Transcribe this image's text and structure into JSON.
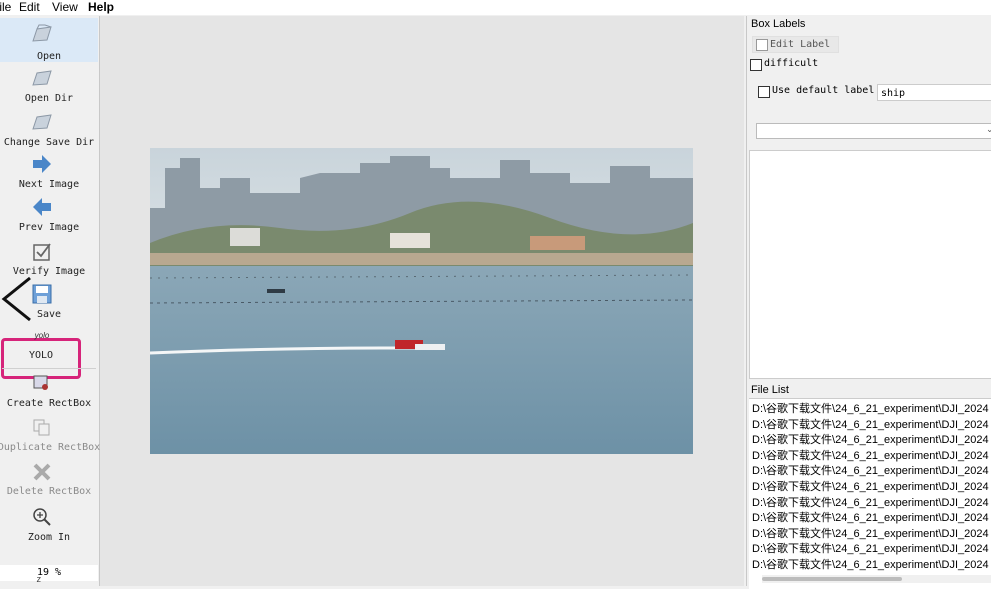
{
  "menubar": {
    "file": "File",
    "edit": "Edit",
    "view": "View",
    "help": "Help"
  },
  "toolbar": {
    "open": "Open",
    "open_dir": "Open Dir",
    "change_save_dir": "Change Save Dir",
    "next_image": "Next Image",
    "prev_image": "Prev Image",
    "verify_image": "Verify Image",
    "save": "Save",
    "yolo_icon_text": "yolo",
    "yolo": "YOLO",
    "create_rectbox": "Create RectBox",
    "duplicate_rectbox": "Duplicate RectBox",
    "delete_rectbox": "Delete RectBox",
    "zoom_in": "Zoom In",
    "zoom_value": "19 %",
    "more": "z"
  },
  "dock": {
    "box_labels_title": "Box Labels",
    "edit_label": "Edit Label",
    "difficult": "difficult",
    "use_default_label": "Use default label",
    "default_label_value": "ship",
    "file_list_title": "File List",
    "files": [
      "D:\\谷歌下载文件\\24_6_21_experiment\\DJI_2024",
      "D:\\谷歌下载文件\\24_6_21_experiment\\DJI_2024",
      "D:\\谷歌下载文件\\24_6_21_experiment\\DJI_2024",
      "D:\\谷歌下载文件\\24_6_21_experiment\\DJI_2024",
      "D:\\谷歌下载文件\\24_6_21_experiment\\DJI_2024",
      "D:\\谷歌下载文件\\24_6_21_experiment\\DJI_2024",
      "D:\\谷歌下载文件\\24_6_21_experiment\\DJI_2024",
      "D:\\谷歌下载文件\\24_6_21_experiment\\DJI_2024",
      "D:\\谷歌下载文件\\24_6_21_experiment\\DJI_2024",
      "D:\\谷歌下载文件\\24_6_21_experiment\\DJI_2024",
      "D:\\谷歌下载文件\\24_6_21_experiment\\DJI_2024"
    ]
  },
  "colors": {
    "highlight_box": "#d6247a",
    "accent_arrow": "#4a86c8",
    "selected_tool": "#dbe9f7"
  }
}
